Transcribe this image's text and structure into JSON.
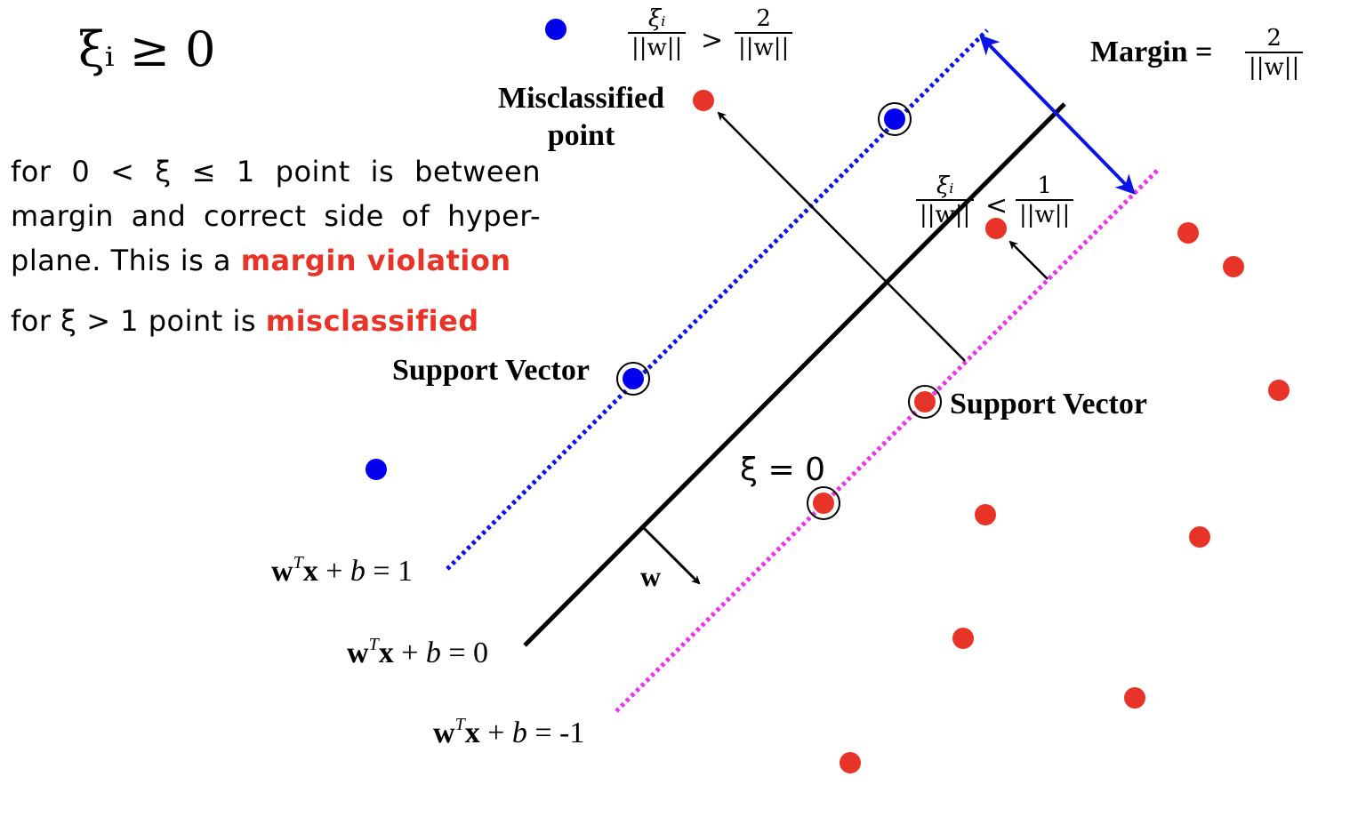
{
  "colors": {
    "positive_class": "#0000ee",
    "negative_class": "#e83428",
    "margin_plus_line": "#0a14e6",
    "margin_minus_line": "#ee33ee",
    "hyperplane": "#000000",
    "margin_arrow": "#0a14e6",
    "highlight_text": "#e83428"
  },
  "heading": {
    "formula": "ξᵢ ≥ 0"
  },
  "explanation": {
    "line1_prefix": "for 0 < ξ ≤ 1 point is between margin and correct side of hyper-plane. This is a ",
    "line1_highlight": "margin violation",
    "line2_prefix": "for ξ > 1 point is ",
    "line2_highlight": "misclassified"
  },
  "labels": {
    "misclassified_point": "Misclassified",
    "misclassified_point_2": "point",
    "support_vector_left": "Support Vector",
    "support_vector_right": "Support Vector",
    "xi_zero": "ξ = 0",
    "w_vector": "w",
    "margin_label": "Margin ="
  },
  "fractions": {
    "misclassified": {
      "lhs_num": "ξᵢ",
      "lhs_den": "||w||",
      "op": ">",
      "rhs_num": "2",
      "rhs_den": "||w||"
    },
    "violation": {
      "lhs_num": "ξᵢ",
      "lhs_den": "||w||",
      "op": "<",
      "rhs_num": "1",
      "rhs_den": "||w||"
    },
    "margin": {
      "num": "2",
      "den": "||w||"
    }
  },
  "equations": {
    "plus": {
      "w": "w",
      "T": "T",
      "x": "x",
      "rest": " + ",
      "b": "b",
      "rhs": " = 1"
    },
    "zero": {
      "w": "w",
      "T": "T",
      "x": "x",
      "rest": " + ",
      "b": "b",
      "rhs": " = 0"
    },
    "minus": {
      "w": "w",
      "T": "T",
      "x": "x",
      "rest": " + ",
      "b": "b",
      "rhs": " = -1"
    }
  },
  "points": {
    "positive": [
      {
        "label": "blue-point",
        "support_vector": false
      },
      {
        "label": "blue-point-support-upper",
        "support_vector": true
      },
      {
        "label": "blue-point-support-lower",
        "support_vector": true
      },
      {
        "label": "blue-point-far",
        "support_vector": false
      }
    ],
    "negative": [
      {
        "label": "red-point-misclassified",
        "support_vector": false
      },
      {
        "label": "red-point-margin-violation",
        "support_vector": false
      },
      {
        "label": "red-point-support-upper",
        "support_vector": true
      },
      {
        "label": "red-point-support-lower",
        "support_vector": true
      },
      {
        "label": "red-point",
        "support_vector": false
      }
    ]
  }
}
